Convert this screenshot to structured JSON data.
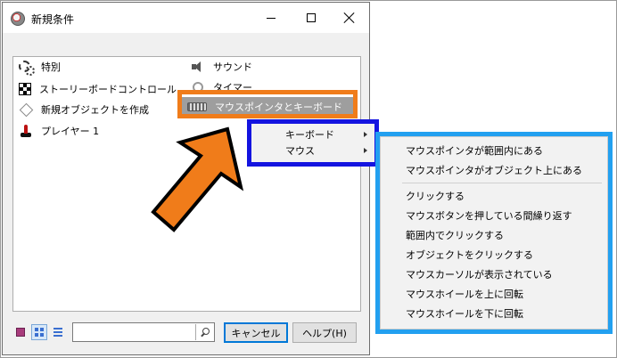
{
  "window": {
    "title": "新規条件"
  },
  "list_items": [
    {
      "label": "特別",
      "icon": "gears-icon"
    },
    {
      "label": "ストーリーボードコントロール",
      "icon": "storyboard-icon"
    },
    {
      "label": "新規オブジェクトを作成",
      "icon": "new-object-icon"
    },
    {
      "label": "プレイヤー 1",
      "icon": "player-icon"
    },
    {
      "label": "サウンド",
      "icon": "speaker-icon"
    },
    {
      "label": "タイマー",
      "icon": "timer-icon"
    },
    {
      "label": "マウスポインタとキーボード",
      "icon": "keyboard-icon"
    }
  ],
  "submenu": [
    {
      "label": "キーボード"
    },
    {
      "label": "マウス"
    }
  ],
  "context_menu": {
    "group1": [
      "マウスポインタが範囲内にある",
      "マウスポインタがオブジェクト上にある"
    ],
    "group2": [
      "クリックする",
      "マウスボタンを押している間繰り返す",
      "範囲内でクリックする",
      "オブジェクトをクリックする",
      "マウスカーソルが表示されている",
      "マウスホイールを上に回転",
      "マウスホイールを下に回転"
    ]
  },
  "buttons": {
    "cancel": "キャンセル",
    "help": "ヘルプ(H)"
  },
  "search": {
    "value": ""
  },
  "colors": {
    "orange": "#f07c1a",
    "blue": "#1414e0",
    "cyan": "#22a0f0",
    "selected_bg": "#9e9e9e"
  }
}
